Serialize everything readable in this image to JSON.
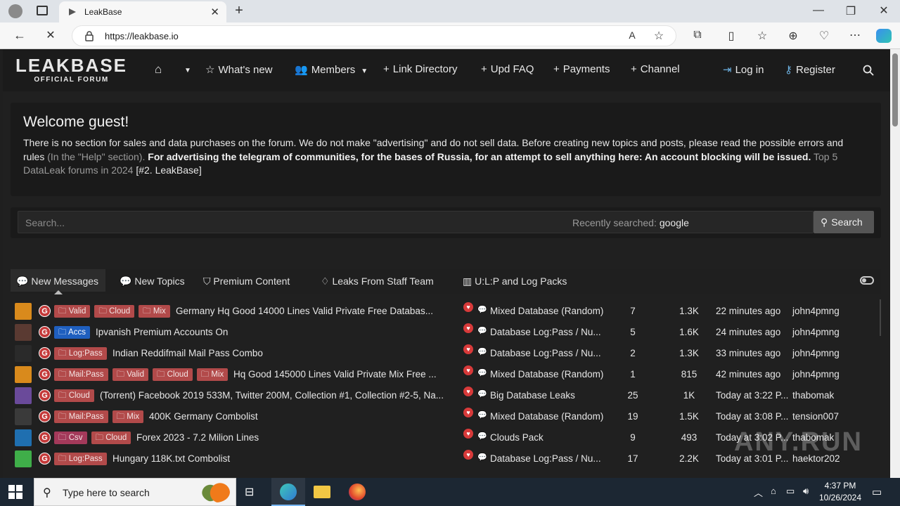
{
  "browser": {
    "tab_title": "LeakBase",
    "url": "https://leakbase.io"
  },
  "site": {
    "logo_line1": "LEAKBASE",
    "logo_line2": "OFFICIAL FORUM",
    "nav": {
      "whats_new": "What's new",
      "members": "Members",
      "link_directory": "Link Directory",
      "upd_faq": "Upd FAQ",
      "payments": "Payments",
      "channel": "Channel",
      "login": "Log in",
      "register": "Register"
    },
    "welcome": {
      "title": "Welcome guest!",
      "text1": "There is no section for sales and data purchases on the forum. We do not make \"advertising\" and do not sell data. Before creating new topics and posts, please read the possible errors and rules",
      "text2": "(In the \"Help\" section).",
      "text3": "For advertising the telegram of communities, for the bases of Russia, for an attempt to sell anything here: An account blocking will be issued.",
      "text4": "Top 5 DataLeak forums in 2024",
      "text5": "[#2. LeakBase]"
    },
    "search": {
      "placeholder": "Search...",
      "recent_label": "Recently searched:",
      "recent_term": "google",
      "button": "Search"
    },
    "feed_tabs": [
      "New Messages",
      "New Topics",
      "Premium Content",
      "Leaks From Staff Team",
      "U:L:P and Log Packs"
    ],
    "threads": [
      {
        "tags": [
          "Valid",
          "Cloud",
          "Mix"
        ],
        "tag_styles": [
          "",
          "",
          ""
        ],
        "title": "Germany Hq Good 14000 Lines Valid Private Free Databas...",
        "forum": "Mixed Database (Random)",
        "replies": "7",
        "views": "1.3K",
        "time": "22 minutes ago",
        "user": "john4pmng",
        "avatar_color": "#d98a1c"
      },
      {
        "tags": [
          "Accs"
        ],
        "tag_styles": [
          "blue"
        ],
        "title": "Ipvanish Premium Accounts On",
        "forum": "Database Log:Pass / Nu...",
        "replies": "5",
        "views": "1.6K",
        "time": "24 minutes ago",
        "user": "john4pmng",
        "avatar_color": "#5a3a32"
      },
      {
        "tags": [
          "Log:Pass"
        ],
        "tag_styles": [
          ""
        ],
        "title": "Indian Reddifmail Mail Pass Combo",
        "forum": "Database Log:Pass / Nu...",
        "replies": "2",
        "views": "1.3K",
        "time": "33 minutes ago",
        "user": "john4pmng",
        "avatar_color": "#2a2a2a"
      },
      {
        "tags": [
          "Mail:Pass",
          "Valid",
          "Cloud",
          "Mix"
        ],
        "tag_styles": [
          "",
          "",
          "",
          ""
        ],
        "title": "Hq Good 145000 Lines Valid Private Mix Free ...",
        "forum": "Mixed Database (Random)",
        "replies": "1",
        "views": "815",
        "time": "42 minutes ago",
        "user": "john4pmng",
        "avatar_color": "#d98a1c"
      },
      {
        "tags": [
          "Cloud"
        ],
        "tag_styles": [
          ""
        ],
        "title": "(Torrent) Facebook 2019 533M, Twitter 200M, Collection #1, Collection #2-5, Na...",
        "forum": "Big Database Leaks",
        "replies": "25",
        "views": "1K",
        "time": "Today at 3:22 P...",
        "user": "thabomak",
        "avatar_color": "#6a4a9a"
      },
      {
        "tags": [
          "Mail:Pass",
          "Mix"
        ],
        "tag_styles": [
          "",
          ""
        ],
        "title": "400K Germany Combolist",
        "forum": "Mixed Database (Random)",
        "replies": "19",
        "views": "1.5K",
        "time": "Today at 3:08 P...",
        "user": "tension007",
        "avatar_color": "#3a3a3a"
      },
      {
        "tags": [
          "Csv",
          "Cloud"
        ],
        "tag_styles": [
          "pink",
          ""
        ],
        "title": "Forex 2023 - 7.2 Milion Lines",
        "forum": "Clouds Pack",
        "replies": "9",
        "views": "493",
        "time": "Today at 3:02 P...",
        "user": "thabomak",
        "avatar_color": "#1f6fb0"
      },
      {
        "tags": [
          "Log:Pass"
        ],
        "tag_styles": [
          ""
        ],
        "title": "Hungary 118K.txt Combolist",
        "forum": "Database Log:Pass / Nu...",
        "replies": "17",
        "views": "2.2K",
        "time": "Today at 3:01 P...",
        "user": "haektor202",
        "avatar_color": "#3fae49"
      }
    ]
  },
  "taskbar": {
    "search_placeholder": "Type here to search",
    "time": "4:37 PM",
    "date": "10/26/2024"
  },
  "watermark": "ANY.RUN"
}
